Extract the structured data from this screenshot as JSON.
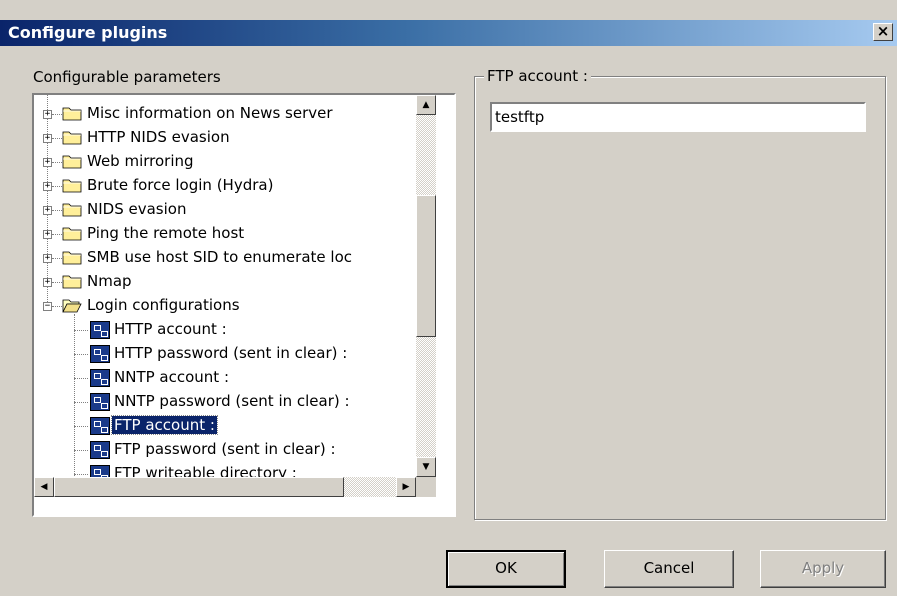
{
  "window": {
    "title": "Configure plugins",
    "close_glyph": "×"
  },
  "left_label": "Configurable parameters",
  "tree": {
    "items": [
      {
        "label": "Misc information on News server",
        "expander": "+",
        "type": "folder"
      },
      {
        "label": "HTTP NIDS evasion",
        "expander": "+",
        "type": "folder"
      },
      {
        "label": "Web mirroring",
        "expander": "+",
        "type": "folder"
      },
      {
        "label": "Brute force login (Hydra)",
        "expander": "+",
        "type": "folder"
      },
      {
        "label": "NIDS evasion",
        "expander": "+",
        "type": "folder"
      },
      {
        "label": "Ping the remote host",
        "expander": "+",
        "type": "folder"
      },
      {
        "label": "SMB use host SID to enumerate loc",
        "expander": "+",
        "type": "folder"
      },
      {
        "label": "Nmap",
        "expander": "+",
        "type": "folder"
      },
      {
        "label": "Login configurations",
        "expander": "−",
        "type": "folder-open"
      },
      {
        "label": "HTTP account :",
        "type": "plugin"
      },
      {
        "label": "HTTP password (sent in clear) :",
        "type": "plugin"
      },
      {
        "label": "NNTP account :",
        "type": "plugin"
      },
      {
        "label": "NNTP password (sent in clear) :",
        "type": "plugin"
      },
      {
        "label": "FTP account :",
        "type": "plugin",
        "selected": true
      },
      {
        "label": "FTP password (sent in clear) :",
        "type": "plugin"
      },
      {
        "label": "FTP writeable directory :",
        "type": "plugin"
      }
    ]
  },
  "scroll": {
    "up": "▲",
    "down": "▼",
    "left": "◀",
    "right": "▶"
  },
  "group": {
    "label": "FTP account :",
    "value": "testftp"
  },
  "buttons": {
    "ok": "OK",
    "cancel": "Cancel",
    "apply": "Apply"
  },
  "colors": {
    "titlebar_start": "#0a246a",
    "titlebar_end": "#a6caf0",
    "face": "#d4d0c8",
    "selection": "#0a246a"
  }
}
